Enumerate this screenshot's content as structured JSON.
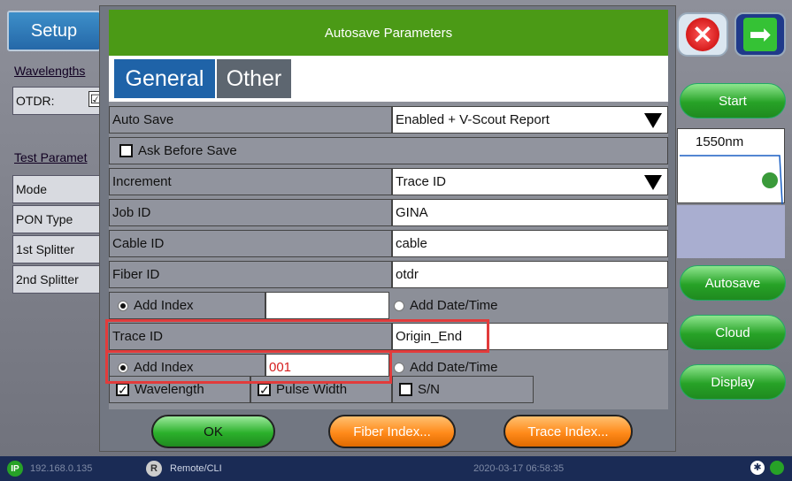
{
  "background": {
    "setup_tab": "Setup",
    "left_labels": [
      "Wavelengths",
      "Test Paramet"
    ],
    "otdr_label": "OTDR:",
    "otdr_check": "☑",
    "left_items": [
      "Mode",
      "PON Type",
      "1st Splitter",
      "2nd Splitter"
    ],
    "right_buttons": {
      "start": "Start",
      "autosave": "Autosave",
      "cloud": "Cloud",
      "display": "Display"
    },
    "graph_wavelength": "1550nm",
    "status": {
      "ip_badge": "IP",
      "ip_text": "192.168.0.135",
      "remote_badge": "R",
      "remote_text": "Remote/CLI",
      "datetime": "2020-03-17 06:58:35"
    }
  },
  "dialog": {
    "title": "Autosave Parameters",
    "tabs": [
      "General",
      "Other"
    ],
    "auto_save": {
      "label": "Auto Save",
      "value": "Enabled + V-Scout Report"
    },
    "ask_before_save": {
      "label": "Ask Before Save",
      "checked": false
    },
    "increment": {
      "label": "Increment",
      "value": "Trace ID"
    },
    "job_id": {
      "label": "Job ID",
      "value": "GINA"
    },
    "cable_id": {
      "label": "Cable ID",
      "value": "cable"
    },
    "fiber_id": {
      "label": "Fiber ID",
      "value": "otdr"
    },
    "fiber_add_index": {
      "label": "Add Index",
      "value": ""
    },
    "fiber_add_datetime": {
      "label": "Add Date/Time"
    },
    "trace_id": {
      "label": "Trace ID",
      "value": "Origin_End"
    },
    "trace_add_index": {
      "label": "Add Index",
      "value": "001"
    },
    "trace_add_datetime": {
      "label": "Add Date/Time"
    },
    "options": {
      "wavelength": "Wavelength",
      "pulse_width": "Pulse Width",
      "sn": "S/N"
    },
    "buttons": {
      "ok": "OK",
      "fiber_index": "Fiber Index...",
      "trace_index": "Trace Index..."
    }
  }
}
